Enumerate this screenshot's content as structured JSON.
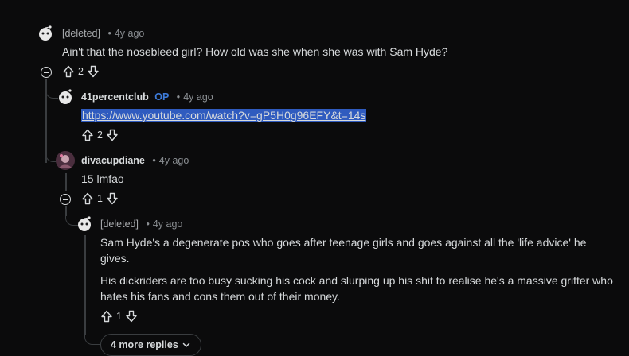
{
  "comments": [
    {
      "author": "[deleted]",
      "time": "4y ago",
      "body": "Ain't that the nosebleed girl? How old was she when she was with Sam Hyde?",
      "votes": "2"
    },
    {
      "author": "41percentclub",
      "op_badge": "OP",
      "time": "4y ago",
      "link_text": "https://www.youtube.com/watch?v=gP5H0g96EFY&t=14s",
      "votes": "2"
    },
    {
      "author": "divacupdiane",
      "time": "4y ago",
      "body": "15 lmfao",
      "votes": "1"
    },
    {
      "author": "[deleted]",
      "time": "4y ago",
      "body_p1": "Sam Hyde's a degenerate pos who goes after teenage girls and goes against all the 'life advice' he gives.",
      "body_p2": "His dickriders are too busy sucking his cock and slurping up his shit to realise he's a massive grifter who hates his fans and cons them out of their money.",
      "votes": "1"
    }
  ],
  "more_replies_label": "4 more replies",
  "separator": "•",
  "icons": {
    "avatar_default": "snoo-avatar-icon",
    "upvote": "upvote-arrow-icon",
    "downvote": "downvote-arrow-icon",
    "collapse": "collapse-thread-icon",
    "chevron": "chevron-down-icon"
  },
  "colors": {
    "background": "#0b0b0c",
    "text": "#d7dadc",
    "meta": "#8b8f93",
    "op": "#3d7bd9",
    "link_highlight": "#2f5bbf",
    "thread_line": "#3a3d40"
  }
}
